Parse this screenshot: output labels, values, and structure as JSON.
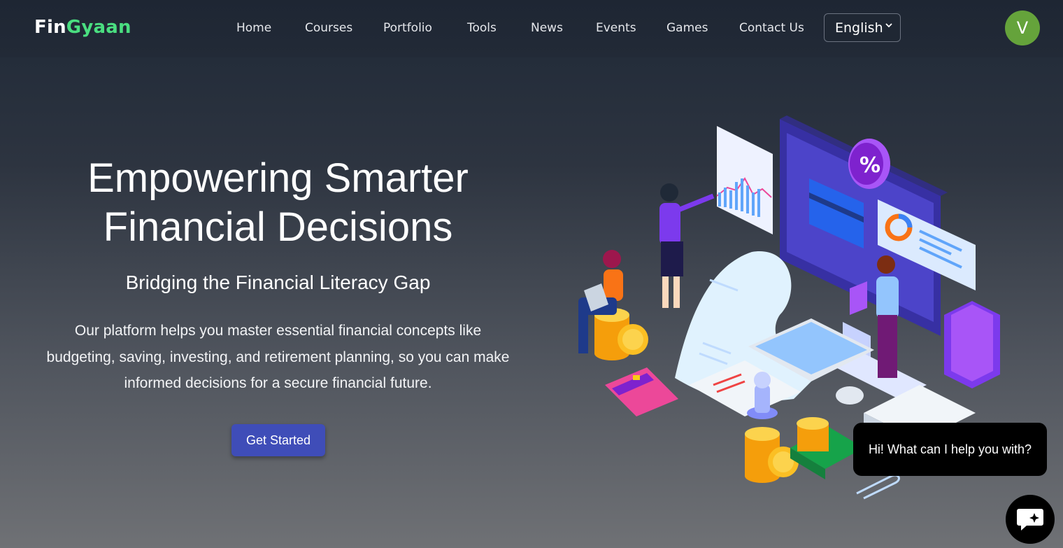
{
  "brand": {
    "part1": "Fin",
    "part2": "Gyaan"
  },
  "nav": {
    "items": [
      {
        "label": "Home"
      },
      {
        "label": "Courses"
      },
      {
        "label": "Portfolio"
      },
      {
        "label": "Tools"
      },
      {
        "label": "News"
      },
      {
        "label": "Events"
      },
      {
        "label": "Games"
      },
      {
        "label": "Contact Us"
      }
    ],
    "language": "English",
    "avatar_initial": "V"
  },
  "hero": {
    "title_line1": "Empowering Smarter",
    "title_line2": "Financial Decisions",
    "subtitle": "Bridging the Financial Literacy Gap",
    "description": "Our platform helps you master essential financial concepts like budgeting, saving, investing, and retirement planning, so you can make informed decisions for a secure financial future.",
    "cta_label": "Get Started"
  },
  "chat": {
    "bubble_text": "Hi! What can I help you with?",
    "fab_icon": "chat-icon"
  },
  "colors": {
    "brand_green": "#4ade80",
    "cta_blue": "#3f4db8",
    "avatar_green": "#65a33b"
  }
}
